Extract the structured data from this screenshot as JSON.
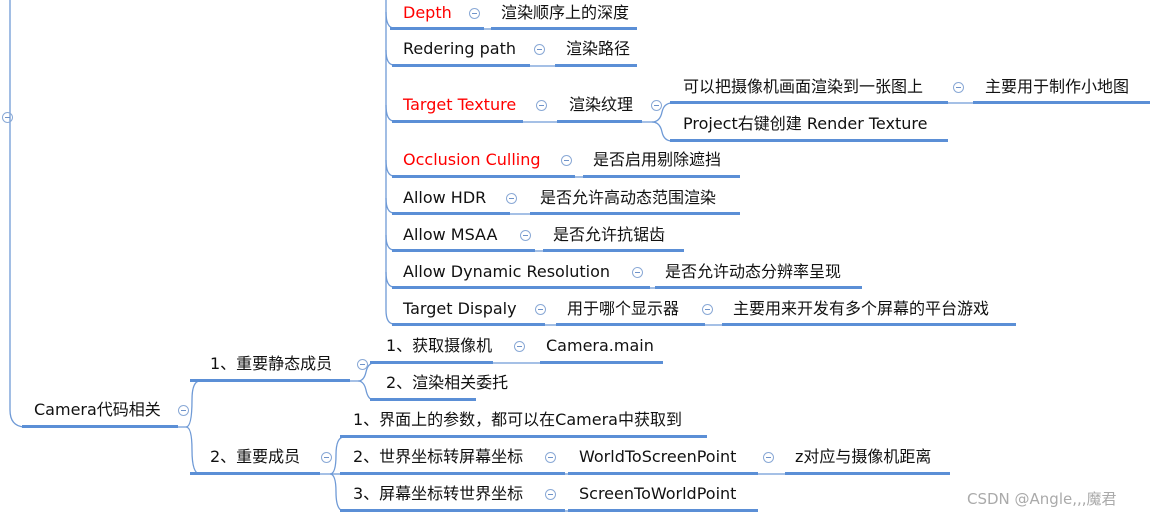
{
  "map": {
    "properties": [
      {
        "label": "Depth",
        "highlight": true,
        "children": [
          "渲染顺序上的深度"
        ]
      },
      {
        "label": "Redering path",
        "highlight": false,
        "children": [
          "渲染路径"
        ]
      },
      {
        "label": "Target Texture",
        "highlight": true,
        "children": [
          "渲染纹理"
        ],
        "grandchildren": [
          "可以把摄像机画面渲染到一张图上",
          "Project右键创建 Render Texture"
        ],
        "great": [
          "主要用于制作小地图"
        ]
      },
      {
        "label": "Occlusion Culling",
        "highlight": true,
        "children": [
          "是否启用剔除遮挡"
        ]
      },
      {
        "label": "Allow HDR",
        "highlight": false,
        "children": [
          "是否允许高动态范围渲染"
        ]
      },
      {
        "label": "Allow MSAA",
        "highlight": false,
        "children": [
          "是否允许抗锯齿"
        ]
      },
      {
        "label": "Allow Dynamic Resolution",
        "highlight": false,
        "children": [
          "是否允许动态分辨率呈现"
        ]
      },
      {
        "label": "Target Dispaly",
        "highlight": false,
        "children": [
          "用于哪个显示器"
        ],
        "grandchildren": [
          "主要用来开发有多个屏幕的平台游戏"
        ]
      }
    ],
    "code": {
      "label": "Camera代码相关",
      "static": {
        "label": "1、重要静态成员",
        "items": [
          "1、获取摄像机",
          "2、渲染相关委托"
        ],
        "sub": [
          "Camera.main"
        ]
      },
      "members": {
        "label": "2、重要成员",
        "items": [
          "1、界面上的参数，都可以在Camera中获取到",
          "2、世界坐标转屏幕坐标",
          "3、屏幕坐标转世界坐标"
        ],
        "sub": [
          "WorldToScreenPoint",
          "ScreenToWorldPoint"
        ],
        "subsub": [
          "z对应与摄像机距离"
        ]
      }
    }
  },
  "watermark": "CSDN @Angle,,,魔君",
  "colors": {
    "line": "#5b8fd6",
    "highlight": "#ff0000"
  }
}
